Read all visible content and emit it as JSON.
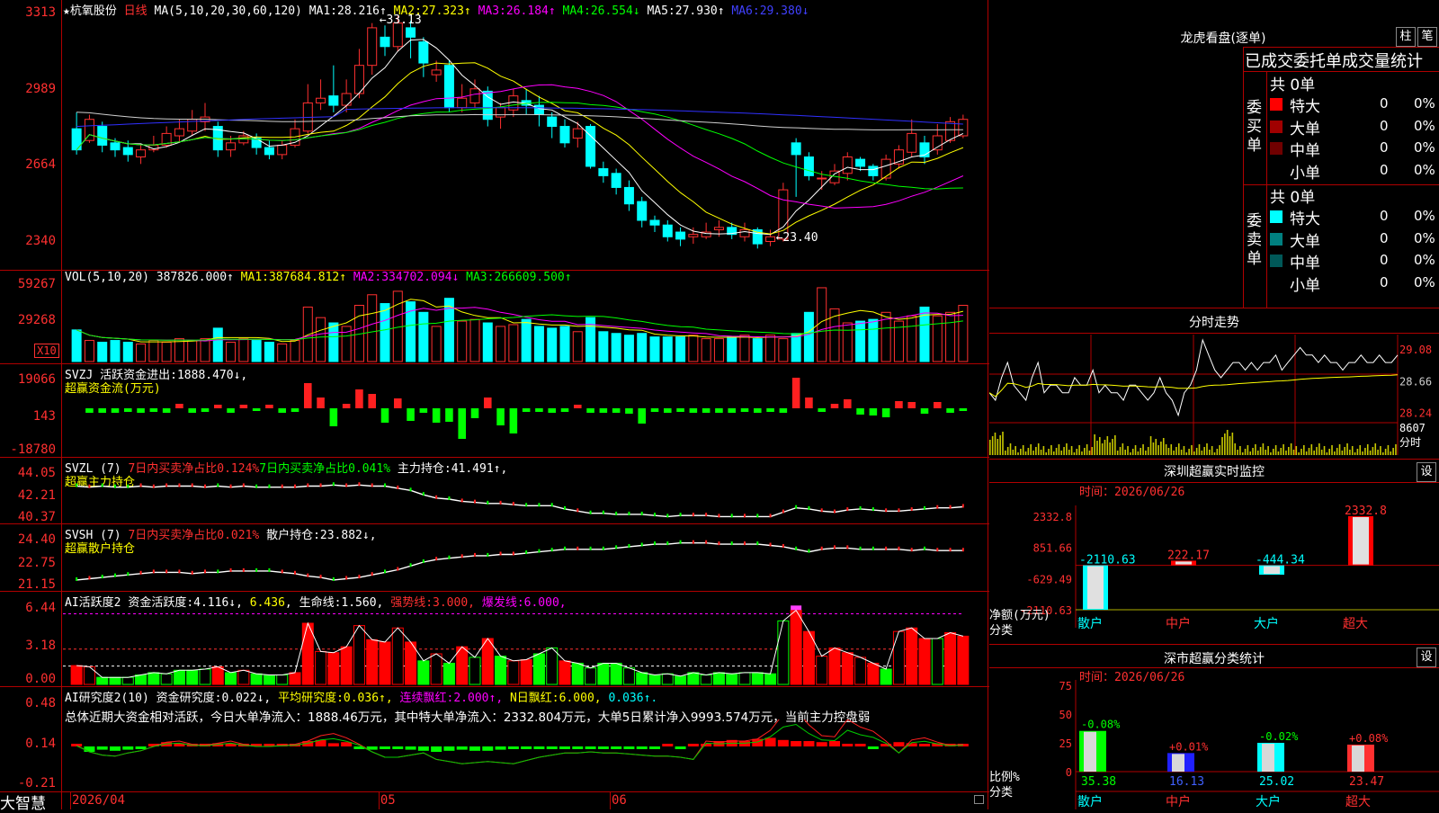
{
  "stock": {
    "name": "★杭氧股份",
    "period": "日线"
  },
  "kline": {
    "ma_header": "MA(5,10,20,30,60,120)",
    "ma": [
      {
        "label": "MA1:",
        "value": "28.216↑",
        "color": "#ffffff"
      },
      {
        "label": "MA2:",
        "value": "27.323↑",
        "color": "#ffff00"
      },
      {
        "label": "MA3:",
        "value": "26.184↑",
        "color": "#ff00ff"
      },
      {
        "label": "MA4:",
        "value": "26.554↓",
        "color": "#00ff00"
      },
      {
        "label": "MA5:",
        "value": "27.930↑",
        "color": "#ffffff"
      },
      {
        "label": "MA6:",
        "value": "29.380↓",
        "color": "#4040ff"
      }
    ],
    "yticks": [
      "3313",
      "2989",
      "2664",
      "2340"
    ],
    "high_label": "33.13",
    "low_label": "23.40",
    "ohlc": [
      [
        28.5,
        27.6,
        29.2,
        27.4
      ],
      [
        28.0,
        28.9,
        29.1,
        27.9
      ],
      [
        28.6,
        27.8,
        28.8,
        27.5
      ],
      [
        27.9,
        27.6,
        28.1,
        27.3
      ],
      [
        27.7,
        27.4,
        28.0,
        27.1
      ],
      [
        27.3,
        27.6,
        27.8,
        27.0
      ],
      [
        27.6,
        27.8,
        28.2,
        27.5
      ],
      [
        27.8,
        28.3,
        28.6,
        27.7
      ],
      [
        28.2,
        28.5,
        28.9,
        27.9
      ],
      [
        28.4,
        28.9,
        29.3,
        28.2
      ],
      [
        28.8,
        29.0,
        29.6,
        28.4
      ],
      [
        28.6,
        27.6,
        28.8,
        27.3
      ],
      [
        27.6,
        27.9,
        28.2,
        27.3
      ],
      [
        27.9,
        28.2,
        28.4,
        27.8
      ],
      [
        28.1,
        27.7,
        28.3,
        27.4
      ],
      [
        27.7,
        27.4,
        28.0,
        27.2
      ],
      [
        27.4,
        27.8,
        28.0,
        27.2
      ],
      [
        27.8,
        28.5,
        28.9,
        27.7
      ],
      [
        28.4,
        29.6,
        30.4,
        28.3
      ],
      [
        29.6,
        29.8,
        30.6,
        29.3
      ],
      [
        29.9,
        29.5,
        31.2,
        29.2
      ],
      [
        29.5,
        30.0,
        30.6,
        29.2
      ],
      [
        30.0,
        31.2,
        31.9,
        29.8
      ],
      [
        31.2,
        32.8,
        33.0,
        30.8
      ],
      [
        32.4,
        32.0,
        32.9,
        31.6
      ],
      [
        32.0,
        33.0,
        33.3,
        31.8
      ],
      [
        32.8,
        32.4,
        33.1,
        31.5
      ],
      [
        32.2,
        31.3,
        32.4,
        30.7
      ],
      [
        30.8,
        31.0,
        31.4,
        30.5
      ],
      [
        31.2,
        29.4,
        31.4,
        29.2
      ],
      [
        29.4,
        29.8,
        30.4,
        29.2
      ],
      [
        29.6,
        30.2,
        30.6,
        29.4
      ],
      [
        30.1,
        28.9,
        30.3,
        28.6
      ],
      [
        29.0,
        29.4,
        29.6,
        28.5
      ],
      [
        29.3,
        29.9,
        30.2,
        29.0
      ],
      [
        29.7,
        29.5,
        30.2,
        29.1
      ],
      [
        29.5,
        29.1,
        29.9,
        28.6
      ],
      [
        29.0,
        28.6,
        29.2,
        28.1
      ],
      [
        28.6,
        27.9,
        28.9,
        27.7
      ],
      [
        28.1,
        28.5,
        28.8,
        27.7
      ],
      [
        28.6,
        26.9,
        28.7,
        26.8
      ],
      [
        26.8,
        26.5,
        27.1,
        26.2
      ],
      [
        26.6,
        26.0,
        26.8,
        25.7
      ],
      [
        26.0,
        25.3,
        26.3,
        25.0
      ],
      [
        25.4,
        24.6,
        25.6,
        24.3
      ],
      [
        24.6,
        24.4,
        24.8,
        24.1
      ],
      [
        24.4,
        23.9,
        24.6,
        23.7
      ],
      [
        24.1,
        23.8,
        24.3,
        23.5
      ],
      [
        23.9,
        24.0,
        24.3,
        23.6
      ],
      [
        23.9,
        24.1,
        24.5,
        23.8
      ],
      [
        24.2,
        24.3,
        24.6,
        23.9
      ],
      [
        24.3,
        24.0,
        24.5,
        23.8
      ],
      [
        23.9,
        24.2,
        24.5,
        23.7
      ],
      [
        24.2,
        23.6,
        24.3,
        23.4
      ],
      [
        23.7,
        23.9,
        24.2,
        23.5
      ],
      [
        23.8,
        25.9,
        26.2,
        23.7
      ],
      [
        27.9,
        27.4,
        28.1,
        25.6
      ],
      [
        27.3,
        26.5,
        27.5,
        26.3
      ],
      [
        26.4,
        26.4,
        26.7,
        25.9
      ],
      [
        26.2,
        26.7,
        27.0,
        26.1
      ],
      [
        26.6,
        27.3,
        27.5,
        26.3
      ],
      [
        27.2,
        26.9,
        27.3,
        26.7
      ],
      [
        26.9,
        26.5,
        27.0,
        26.3
      ],
      [
        26.4,
        27.2,
        27.4,
        26.3
      ],
      [
        27.0,
        27.6,
        27.8,
        26.8
      ],
      [
        27.5,
        28.3,
        28.9,
        27.3
      ],
      [
        27.9,
        27.3,
        28.2,
        27.0
      ],
      [
        27.6,
        28.2,
        28.7,
        27.4
      ],
      [
        28.0,
        28.8,
        29.0,
        27.9
      ],
      [
        28.2,
        28.9,
        29.1,
        28.1
      ]
    ]
  },
  "vol": {
    "title": "VOL(5,10,20)",
    "value": "387826.000↑",
    "ma": [
      {
        "label": "MA1:",
        "value": "387684.812↑",
        "color": "#ffff00"
      },
      {
        "label": "MA2:",
        "value": "334702.094↓",
        "color": "#ff00ff"
      },
      {
        "label": "MA3:",
        "value": "266609.500↑",
        "color": "#00ff00"
      }
    ],
    "yticks": [
      "59267",
      "29268"
    ],
    "unit": "X10",
    "values": [
      180,
      120,
      110,
      120,
      110,
      100,
      120,
      110,
      130,
      120,
      130,
      190,
      110,
      130,
      120,
      110,
      100,
      120,
      310,
      250,
      220,
      200,
      320,
      380,
      330,
      400,
      340,
      280,
      200,
      360,
      230,
      240,
      220,
      200,
      210,
      240,
      200,
      190,
      200,
      170,
      250,
      170,
      160,
      150,
      160,
      140,
      140,
      140,
      150,
      130,
      130,
      140,
      150,
      130,
      150,
      130,
      160,
      280,
      420,
      300,
      220,
      230,
      240,
      280,
      230,
      260,
      310,
      260,
      280,
      320
    ]
  },
  "svzj": {
    "title": "SVZJ",
    "label": "活跃资金进出:",
    "value": "1888.470↓,",
    "sub": "超赢资金流(万元)",
    "yticks": [
      "19066",
      "143",
      "-18780"
    ],
    "values": [
      0,
      -0.5,
      -0.5,
      -0.5,
      -0.4,
      -0.5,
      -0.4,
      -0.5,
      0.5,
      -0.5,
      -0.4,
      0.4,
      -0.5,
      0.4,
      -0.3,
      0.4,
      -0.5,
      -0.4,
      2.8,
      1.2,
      -2.0,
      0.5,
      2.1,
      1.6,
      -1.6,
      1.1,
      -1.4,
      -0.5,
      -1.6,
      -1.5,
      -3.4,
      -1.1,
      1.2,
      -1.9,
      -2.8,
      -0.4,
      -0.4,
      -0.5,
      -0.4,
      0.4,
      -0.5,
      -0.5,
      -0.5,
      -0.6,
      -1.7,
      -0.4,
      -0.5,
      -0.4,
      -0.5,
      -0.5,
      -0.5,
      -0.5,
      -0.4,
      -0.5,
      -0.4,
      -0.5,
      3.6,
      1.2,
      -0.4,
      0.5,
      1.0,
      -0.7,
      -0.8,
      -1.0,
      0.8,
      0.7,
      -0.6,
      0.7,
      -0.5,
      -0.3
    ]
  },
  "svzl": {
    "title": "SVZL (7)",
    "part1": "7日内买卖净占比0.124%",
    "part2": "7日内买卖净占比0.041%",
    "label": "主力持仓:",
    "value": "41.491↑,",
    "sub": "超赢主力持仓",
    "yticks": [
      "44.05",
      "42.21",
      "40.37"
    ],
    "values": [
      43.4,
      43.3,
      43.4,
      43.3,
      43.3,
      43.4,
      43.3,
      43.4,
      43.4,
      43.4,
      43.3,
      43.4,
      43.3,
      43.4,
      43.3,
      43.3,
      43.3,
      43.3,
      43.4,
      43.4,
      43.5,
      43.4,
      43.5,
      43.4,
      43.4,
      43.2,
      43.0,
      42.6,
      42.3,
      42.2,
      42.0,
      41.9,
      41.8,
      41.8,
      41.7,
      41.6,
      41.6,
      41.6,
      41.3,
      41.1,
      40.9,
      40.9,
      40.8,
      40.8,
      40.8,
      40.7,
      40.6,
      40.7,
      40.7,
      40.7,
      40.6,
      40.6,
      40.6,
      40.6,
      40.6,
      41.0,
      41.4,
      41.3,
      41.1,
      41.0,
      41.2,
      41.3,
      41.2,
      41.1,
      41.1,
      41.2,
      41.3,
      41.4,
      41.4,
      41.5
    ]
  },
  "svsh": {
    "title": "SVSH (7)",
    "part1": "7日内买卖净占比0.021%",
    "label": "散户持仓:",
    "value": "23.882↓,",
    "sub": "超赢散户持仓",
    "yticks": [
      "24.40",
      "22.75",
      "21.15"
    ],
    "values": [
      21.6,
      21.7,
      21.8,
      21.9,
      22.0,
      22.1,
      22.2,
      22.2,
      22.2,
      22.1,
      22.2,
      22.2,
      22.3,
      22.3,
      22.3,
      22.3,
      22.2,
      22.1,
      21.9,
      21.8,
      21.6,
      21.7,
      21.8,
      22.0,
      22.2,
      22.4,
      22.7,
      23.0,
      23.2,
      23.3,
      23.4,
      23.5,
      23.5,
      23.6,
      23.6,
      23.7,
      23.8,
      23.9,
      24.0,
      24.0,
      24.0,
      24.0,
      24.1,
      24.2,
      24.3,
      24.4,
      24.4,
      24.5,
      24.5,
      24.5,
      24.4,
      24.4,
      24.4,
      24.4,
      24.3,
      24.2,
      24.0,
      23.8,
      24.0,
      24.1,
      24.1,
      24.0,
      24.0,
      24.0,
      24.0,
      23.9,
      24.0,
      23.9,
      23.9,
      23.9
    ]
  },
  "ai_active": {
    "title": "AI活跃度2",
    "label1": "资金活跃度:",
    "val1": "4.116↓",
    "val2": "6.436",
    "label3": "生命线:",
    "val3": "1.560,",
    "label4": "强势线:",
    "val4": "3.000,",
    "label5": "爆发线:",
    "val5": "6.000,",
    "yticks": [
      "6.44",
      "3.18",
      "0.00"
    ],
    "values": [
      1.6,
      1.5,
      0.6,
      0.6,
      0.6,
      0.8,
      1.0,
      0.9,
      1.2,
      1.2,
      1.3,
      1.5,
      1.0,
      1.2,
      0.9,
      0.8,
      0.8,
      1.0,
      5.2,
      2.8,
      2.7,
      3.2,
      5.0,
      3.8,
      3.6,
      4.8,
      3.6,
      2.0,
      2.6,
      1.8,
      3.2,
      2.3,
      3.9,
      2.4,
      2.0,
      2.1,
      2.6,
      3.1,
      2.0,
      1.8,
      1.4,
      1.8,
      1.8,
      1.4,
      1.0,
      0.8,
      0.9,
      0.7,
      1.0,
      0.8,
      1.0,
      0.9,
      1.0,
      1.0,
      0.9,
      5.4,
      6.3,
      4.5,
      2.4,
      3.1,
      2.7,
      2.3,
      1.8,
      1.3,
      4.5,
      4.8,
      3.9,
      3.9,
      4.4,
      4.1
    ],
    "colors": "rrgggggggggrgrgggrrrrrrrrrrgrgrgrgrrggrgggggggggggggggggrrrrrrrgrrrgrr"
  },
  "ai_research": {
    "title": "AI研究度2(10)",
    "label1": "资金研究度:",
    "val1": "0.022↓,",
    "label2": "平均研究度:",
    "val2": "0.036↑,",
    "label3": "连续飘红:",
    "val3": "2.000↑,",
    "label4": "N日飘红:",
    "val4": "6.000,",
    "val5": "0.036↑.",
    "summary": "总体近期大资金相对活跃，今日大单净流入：1888.46万元，其中特大单净流入：2332.804万元，大单5日累计净入9993.574万元，当前主力控盘弱",
    "yticks": [
      "0.48",
      "0.14",
      "-0.21"
    ],
    "values": [
      0.01,
      -0.05,
      -0.03,
      -0.04,
      -0.03,
      -0.01,
      0.02,
      0.04,
      0.03,
      0.0,
      0.02,
      0.03,
      0.0,
      0.02,
      0.01,
      0.02,
      0.0,
      0.01,
      0.05,
      0.06,
      0.03,
      0.04,
      -0.02,
      -0.03,
      -0.02,
      -0.02,
      -0.03,
      -0.04,
      -0.05,
      -0.04,
      -0.03,
      -0.04,
      -0.04,
      -0.03,
      -0.02,
      -0.01,
      -0.02,
      -0.02,
      -0.02,
      -0.02,
      -0.01,
      -0.01,
      -0.01,
      -0.01,
      -0.01,
      -0.01,
      0.0,
      -0.01,
      0.0,
      0.02,
      0.05,
      0.06,
      0.05,
      0.07,
      0.08,
      0.06,
      0.05,
      0.05,
      0.04,
      0.05,
      0.02,
      0.0,
      -0.01,
      0.01,
      0.04,
      0.03,
      0.02,
      0.03,
      0.02,
      0.02
    ],
    "line": [
      0.01,
      -0.05,
      -0.08,
      -0.09,
      -0.06,
      -0.04,
      0.0,
      0.04,
      0.05,
      0.02,
      0.01,
      0.03,
      0.05,
      0.02,
      0.0,
      0.0,
      0.01,
      0.02,
      0.05,
      0.1,
      0.12,
      0.08,
      0.02,
      -0.05,
      -0.1,
      -0.1,
      -0.08,
      -0.06,
      -0.12,
      -0.14,
      -0.16,
      -0.15,
      -0.14,
      -0.15,
      -0.16,
      -0.13,
      -0.1,
      -0.08,
      -0.06,
      -0.06,
      -0.05,
      -0.06,
      -0.06,
      -0.07,
      -0.08,
      -0.09,
      -0.09,
      -0.1,
      -0.12,
      0.05,
      0.04,
      0.05,
      0.05,
      0.07,
      0.15,
      0.3,
      0.34,
      0.2,
      0.1,
      0.09,
      0.25,
      0.18,
      0.14,
      0.05,
      -0.06,
      0.06,
      0.08,
      0.04,
      0.01,
      0.02
    ]
  },
  "xaxis": {
    "ticks": [
      {
        "label": "2026/04",
        "idx": 0
      },
      {
        "label": "05",
        "idx": 24
      },
      {
        "label": "06",
        "idx": 42
      }
    ]
  },
  "brand": "大智慧",
  "right": {
    "dragon_title": "龙虎看盘(逐单)",
    "btn_zhu": "柱",
    "btn_bi": "笔",
    "ob_header": "已成交委托单成交量统计",
    "buy": {
      "label": "委买单",
      "count": "共 0单",
      "rows": [
        {
          "name": "特大",
          "val": "0",
          "pct": "0%",
          "color": "#ff0000"
        },
        {
          "name": "大单",
          "val": "0",
          "pct": "0%",
          "color": "#a00000"
        },
        {
          "name": "中单",
          "val": "0",
          "pct": "0%",
          "color": "#700000"
        },
        {
          "name": "小单",
          "val": "0",
          "pct": "0%",
          "color": "#000000"
        }
      ]
    },
    "sell": {
      "label": "委卖单",
      "count": "共 0单",
      "rows": [
        {
          "name": "特大",
          "val": "0",
          "pct": "0%",
          "color": "#00ffff"
        },
        {
          "name": "大单",
          "val": "0",
          "pct": "0%",
          "color": "#008080"
        },
        {
          "name": "中单",
          "val": "0",
          "pct": "0%",
          "color": "#005858"
        },
        {
          "name": "小单",
          "val": "0",
          "pct": "0%",
          "color": "#000000"
        }
      ]
    },
    "intraday": {
      "title": "分时走势",
      "yticks": [
        "29.08",
        "28.66",
        "28.24"
      ],
      "vol_label": "8607",
      "unit": "分时",
      "price": [
        28.5,
        28.4,
        28.7,
        28.9,
        28.6,
        28.5,
        28.4,
        28.7,
        28.9,
        28.5,
        28.6,
        28.6,
        28.5,
        28.5,
        28.7,
        28.6,
        28.6,
        28.8,
        28.5,
        28.6,
        28.5,
        28.5,
        28.4,
        28.6,
        28.6,
        28.5,
        28.4,
        28.5,
        28.7,
        28.5,
        28.4,
        28.2,
        28.5,
        28.6,
        28.8,
        29.2,
        29.0,
        28.8,
        28.7,
        28.8,
        28.9,
        28.9,
        28.8,
        28.9,
        28.8,
        28.9,
        28.9,
        29.0,
        28.8,
        28.9,
        29.0,
        29.1,
        29.0,
        29.0,
        28.9,
        29.0,
        28.9,
        28.9,
        28.8,
        28.9,
        28.9,
        29.0,
        28.9,
        28.9,
        29.0,
        28.9,
        28.9,
        29.0
      ]
    },
    "sz_monitor": {
      "title": "深圳超赢实时监控",
      "btn": "设",
      "time_label": "时间：",
      "date": "2026/06/26",
      "yticks": [
        "2332.8",
        "851.66",
        "-629.49",
        "-2110.63"
      ],
      "ylabel": "净额(万元)",
      "xlabel": "分类",
      "categories": [
        {
          "name": "散户",
          "value": -2110.63,
          "label": "-2110.63",
          "color": "#00ffff"
        },
        {
          "name": "中户",
          "value": 222.17,
          "label": "222.17",
          "color": "#ff0000"
        },
        {
          "name": "大户",
          "value": -444.34,
          "label": "-444.34",
          "color": "#00ffff"
        },
        {
          "name": "超大",
          "value": 2332.8,
          "label": "2332.8",
          "color": "#ff0000"
        }
      ]
    },
    "sz_class": {
      "title": "深市超赢分类统计",
      "btn": "设",
      "time_label": "时间：",
      "date": "2026/06/26",
      "yticks": [
        "75",
        "50",
        "25",
        "0"
      ],
      "ylabel": "比例%",
      "xlabel": "分类",
      "categories": [
        {
          "name": "散户",
          "value": 35.38,
          "label": "35.38",
          "change": "-0.08%",
          "change_color": "#00ff00",
          "color": "#00ff00"
        },
        {
          "name": "中户",
          "value": 16.13,
          "label": "16.13",
          "change": "+0.01%",
          "change_color": "#ff3030",
          "color": "#2020ff"
        },
        {
          "name": "大户",
          "value": 25.02,
          "label": "25.02",
          "change": "-0.02%",
          "change_color": "#00ff00",
          "color": "#00ffff"
        },
        {
          "name": "超大",
          "value": 23.47,
          "label": "23.47",
          "change": "+0.08%",
          "change_color": "#ff3030",
          "color": "#ff3030"
        }
      ]
    }
  }
}
